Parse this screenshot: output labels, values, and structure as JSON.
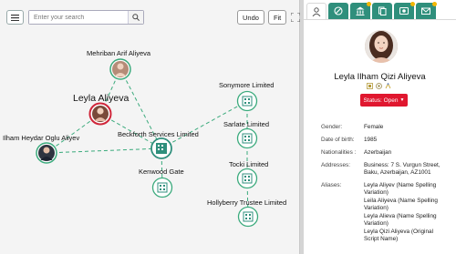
{
  "toolbar": {
    "search_placeholder": "Enter your search",
    "undo_label": "Undo",
    "fit_label": "Fit"
  },
  "graph": {
    "nodes": [
      {
        "id": "mehriban",
        "label": "Mehriban Arif Aliyeva",
        "kind": "person"
      },
      {
        "id": "leyla",
        "label": "Leyla Aliyeva",
        "kind": "person-selected"
      },
      {
        "id": "ilham",
        "label": "Ilham Heydar Oglu Aliyev",
        "kind": "person"
      },
      {
        "id": "beckforth",
        "label": "Beckforth Services Limited",
        "kind": "company-active"
      },
      {
        "id": "kenwood",
        "label": "Kenwood Gate",
        "kind": "company"
      },
      {
        "id": "sonymore",
        "label": "Sonymore Limited",
        "kind": "company"
      },
      {
        "id": "sarlate",
        "label": "Sarlate Limited",
        "kind": "company"
      },
      {
        "id": "tocki",
        "label": "Tocki Limited",
        "kind": "company"
      },
      {
        "id": "hollyberry",
        "label": "Hollyberry Trustee Limited",
        "kind": "company"
      }
    ]
  },
  "profile": {
    "name": "Leyla Ilham Qizi Aliyeva",
    "status": "Status: Open",
    "fields": [
      {
        "key": "Gender:",
        "value": "Female"
      },
      {
        "key": "Date of birth:",
        "value": "1985"
      },
      {
        "key": "Nationalities :",
        "value": "Azerbaijan"
      },
      {
        "key": "Addresses:",
        "value": "Business: 7 S. Vurgun Street, Baku, Azerbaijan, AZ1001"
      }
    ],
    "aliases_key": "Aliases:",
    "aliases": [
      "Leyla Aliyev (Name Spelling Variation)",
      "Leila Aliyeva (Name Spelling Variation)",
      "Leyla Alieva (Name Spelling Variation)",
      "Leyla Qizi Aliyeva (Original Script Name)"
    ]
  },
  "colors": {
    "accent": "#2f8f7c",
    "link": "#3aaa7c",
    "status": "#e0172f",
    "selected_ring": "#d0263a"
  }
}
